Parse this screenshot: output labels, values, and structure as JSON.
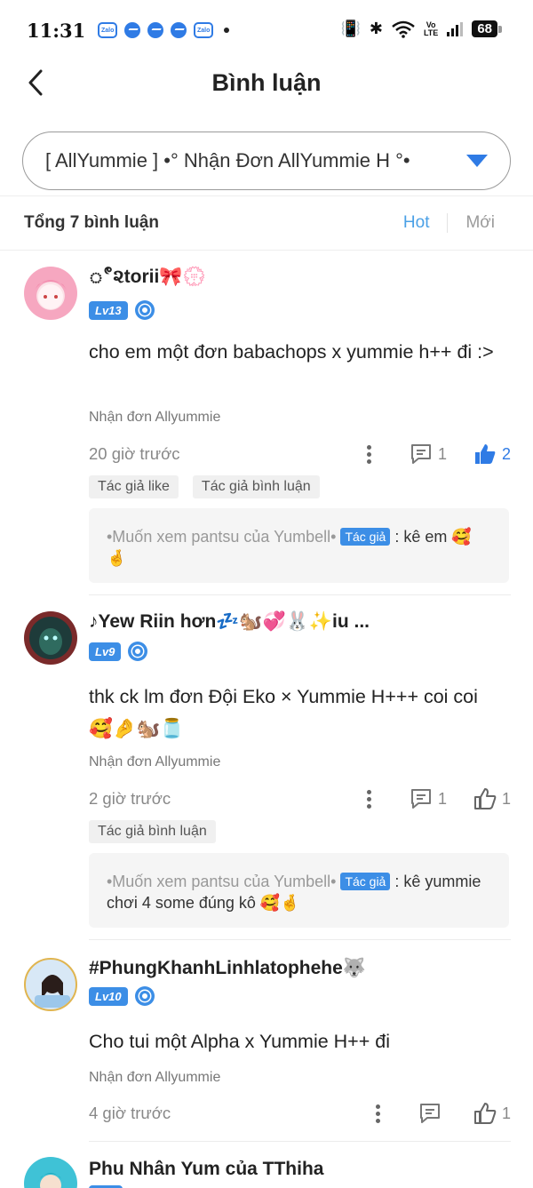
{
  "status_bar": {
    "time": "11:31",
    "notifications": [
      "Zalo",
      "messenger",
      "messenger",
      "messenger",
      "Zalo"
    ],
    "battery": "68",
    "network_label_top": "Vo",
    "network_label_bottom": "LTE"
  },
  "header": {
    "title": "Bình luận"
  },
  "selector": {
    "value": "[ AllYummie ] •° Nhận Đơn AllYummie H °•"
  },
  "sort_bar": {
    "total": "Tổng 7 bình luận",
    "hot_label": "Hot",
    "new_label": "Mới"
  },
  "comments": [
    {
      "username": "ீ૨torii🎀💮",
      "level": "Lv13",
      "text": "cho em một đơn babachops x yummie h++ đi :>",
      "note": "Nhận đơn Allyummie",
      "time": "20 giờ trước",
      "replies_count": "1",
      "likes_count": "2",
      "liked": true,
      "tags": [
        "Tác giả like",
        "Tác giả bình luận"
      ],
      "reply": {
        "name": "•Muốn xem pantsu của Yumbell•",
        "author_tag": "Tác giả",
        "text": ": kê em 🥰🤞"
      }
    },
    {
      "username": "♪Yew Riin hơn💤🐿️💞🐰✨iu ...",
      "level": "Lv9",
      "text": "thk ck lm đơn Đội Eko × Yummie H+++ coi coi 🥰🤌🐿️🫙",
      "note": "Nhận đơn Allyummie",
      "time": "2 giờ trước",
      "replies_count": "1",
      "likes_count": "1",
      "liked": false,
      "tags": [
        "Tác giả bình luận"
      ],
      "reply": {
        "name": "•Muốn xem pantsu của Yumbell•",
        "author_tag": "Tác giả",
        "text": ": kê yummie chơi 4 some đúng kô 🥰🤞"
      }
    },
    {
      "username": "#PhungKhanhLinhlatophehe🐺",
      "level": "Lv10",
      "text": "Cho tui một Alpha x Yummie H++ đi",
      "note": "Nhận đơn Allyummie",
      "time": "4 giờ trước",
      "replies_count": "",
      "likes_count": "1",
      "liked": false
    },
    {
      "username": "Phu Nhân Yum của TThiha"
    }
  ],
  "colors": {
    "accent": "#3c8ee6",
    "hot": "#4aa0e6",
    "muted": "#888888"
  }
}
